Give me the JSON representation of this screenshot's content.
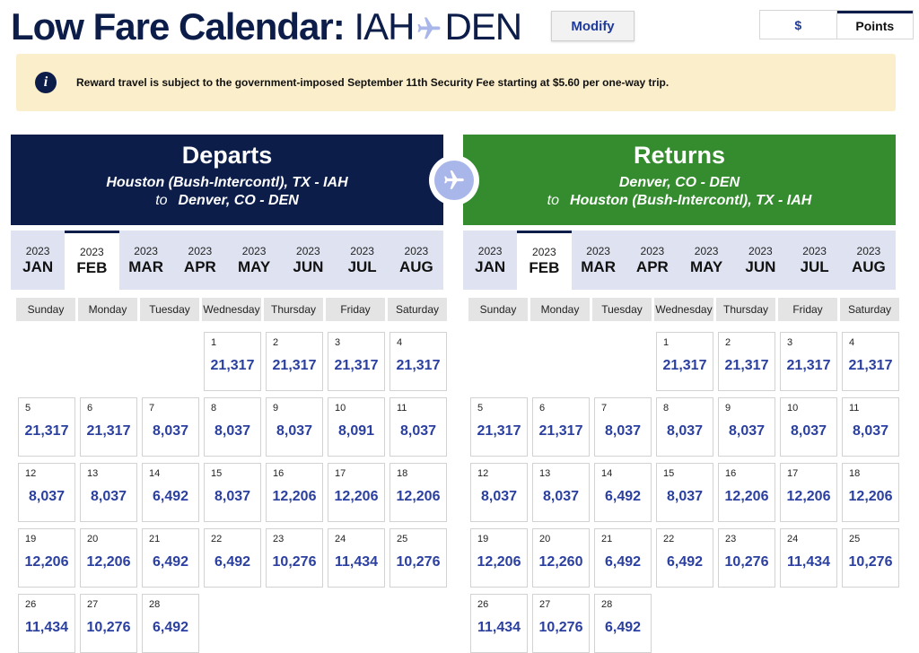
{
  "title": {
    "label": "Low Fare Calendar:",
    "origin": "IAH",
    "destination": "DEN"
  },
  "modify_label": "Modify",
  "currency_toggle": {
    "dollar": "$",
    "points": "Points",
    "active": "Points"
  },
  "notice": "Reward travel is subject to the government-imposed September 11th Security Fee starting at $5.60 per one-way trip.",
  "colors": {
    "navy": "#0c1d4a",
    "green": "#348c2e",
    "fare_text": "#2a3fa0",
    "notice_bg": "#fbeecb"
  },
  "departs": {
    "heading": "Departs",
    "from": "Houston (Bush-Intercontl), TX - IAH",
    "to_word": "to",
    "to": "Denver, CO - DEN",
    "months": [
      {
        "year": "2023",
        "month": "JAN"
      },
      {
        "year": "2023",
        "month": "FEB",
        "active": true
      },
      {
        "year": "2023",
        "month": "MAR"
      },
      {
        "year": "2023",
        "month": "APR"
      },
      {
        "year": "2023",
        "month": "MAY"
      },
      {
        "year": "2023",
        "month": "JUN"
      },
      {
        "year": "2023",
        "month": "JUL"
      },
      {
        "year": "2023",
        "month": "AUG"
      }
    ],
    "days": [
      {
        "day": "1",
        "fare": "21,317"
      },
      {
        "day": "2",
        "fare": "21,317"
      },
      {
        "day": "3",
        "fare": "21,317"
      },
      {
        "day": "4",
        "fare": "21,317"
      },
      {
        "day": "5",
        "fare": "21,317"
      },
      {
        "day": "6",
        "fare": "21,317"
      },
      {
        "day": "7",
        "fare": "8,037"
      },
      {
        "day": "8",
        "fare": "8,037"
      },
      {
        "day": "9",
        "fare": "8,037"
      },
      {
        "day": "10",
        "fare": "8,091"
      },
      {
        "day": "11",
        "fare": "8,037"
      },
      {
        "day": "12",
        "fare": "8,037"
      },
      {
        "day": "13",
        "fare": "8,037"
      },
      {
        "day": "14",
        "fare": "6,492"
      },
      {
        "day": "15",
        "fare": "8,037"
      },
      {
        "day": "16",
        "fare": "12,206"
      },
      {
        "day": "17",
        "fare": "12,206"
      },
      {
        "day": "18",
        "fare": "12,206"
      },
      {
        "day": "19",
        "fare": "12,206"
      },
      {
        "day": "20",
        "fare": "12,206"
      },
      {
        "day": "21",
        "fare": "6,492"
      },
      {
        "day": "22",
        "fare": "6,492"
      },
      {
        "day": "23",
        "fare": "10,276"
      },
      {
        "day": "24",
        "fare": "11,434"
      },
      {
        "day": "25",
        "fare": "10,276"
      },
      {
        "day": "26",
        "fare": "11,434"
      },
      {
        "day": "27",
        "fare": "10,276"
      },
      {
        "day": "28",
        "fare": "6,492"
      }
    ]
  },
  "returns": {
    "heading": "Returns",
    "from": "Denver, CO - DEN",
    "to_word": "to",
    "to": "Houston (Bush-Intercontl), TX - IAH",
    "months": [
      {
        "year": "2023",
        "month": "JAN"
      },
      {
        "year": "2023",
        "month": "FEB",
        "active": true
      },
      {
        "year": "2023",
        "month": "MAR"
      },
      {
        "year": "2023",
        "month": "APR"
      },
      {
        "year": "2023",
        "month": "MAY"
      },
      {
        "year": "2023",
        "month": "JUN"
      },
      {
        "year": "2023",
        "month": "JUL"
      },
      {
        "year": "2023",
        "month": "AUG"
      }
    ],
    "days": [
      {
        "day": "1",
        "fare": "21,317"
      },
      {
        "day": "2",
        "fare": "21,317"
      },
      {
        "day": "3",
        "fare": "21,317"
      },
      {
        "day": "4",
        "fare": "21,317"
      },
      {
        "day": "5",
        "fare": "21,317"
      },
      {
        "day": "6",
        "fare": "21,317"
      },
      {
        "day": "7",
        "fare": "8,037"
      },
      {
        "day": "8",
        "fare": "8,037"
      },
      {
        "day": "9",
        "fare": "8,037"
      },
      {
        "day": "10",
        "fare": "8,037"
      },
      {
        "day": "11",
        "fare": "8,037"
      },
      {
        "day": "12",
        "fare": "8,037"
      },
      {
        "day": "13",
        "fare": "8,037"
      },
      {
        "day": "14",
        "fare": "6,492"
      },
      {
        "day": "15",
        "fare": "8,037"
      },
      {
        "day": "16",
        "fare": "12,206"
      },
      {
        "day": "17",
        "fare": "12,206"
      },
      {
        "day": "18",
        "fare": "12,206"
      },
      {
        "day": "19",
        "fare": "12,206"
      },
      {
        "day": "20",
        "fare": "12,260"
      },
      {
        "day": "21",
        "fare": "6,492"
      },
      {
        "day": "22",
        "fare": "6,492"
      },
      {
        "day": "23",
        "fare": "10,276"
      },
      {
        "day": "24",
        "fare": "11,434"
      },
      {
        "day": "25",
        "fare": "10,276"
      },
      {
        "day": "26",
        "fare": "11,434"
      },
      {
        "day": "27",
        "fare": "10,276"
      },
      {
        "day": "28",
        "fare": "6,492"
      }
    ]
  },
  "weekdays": [
    "Sunday",
    "Monday",
    "Tuesday",
    "Wednesday",
    "Thursday",
    "Friday",
    "Saturday"
  ],
  "first_weekday_index": 3
}
